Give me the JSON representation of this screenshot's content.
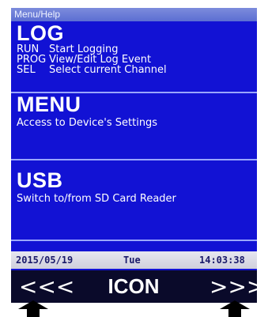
{
  "title_bar": "Menu/Help",
  "log": {
    "heading": "LOG",
    "rows": [
      {
        "key": "RUN",
        "value": "Start Logging"
      },
      {
        "key": "PROG",
        "value": "View/Edit Log Event"
      },
      {
        "key": "SEL",
        "value": "Select current Channel"
      }
    ]
  },
  "menu": {
    "heading": "MENU",
    "description": "Access to Device's Settings"
  },
  "usb": {
    "heading": "USB",
    "description": "Switch to/from SD Card Reader"
  },
  "status": {
    "date": "2015/05/19",
    "day": "Tue",
    "time": "14:03:38"
  },
  "nav": {
    "left_label": "<<<",
    "center_label": "ICON",
    "right_label": ">>>"
  },
  "icons": {
    "left_arrow": "arrow-up-icon",
    "right_arrow": "arrow-up-icon"
  }
}
